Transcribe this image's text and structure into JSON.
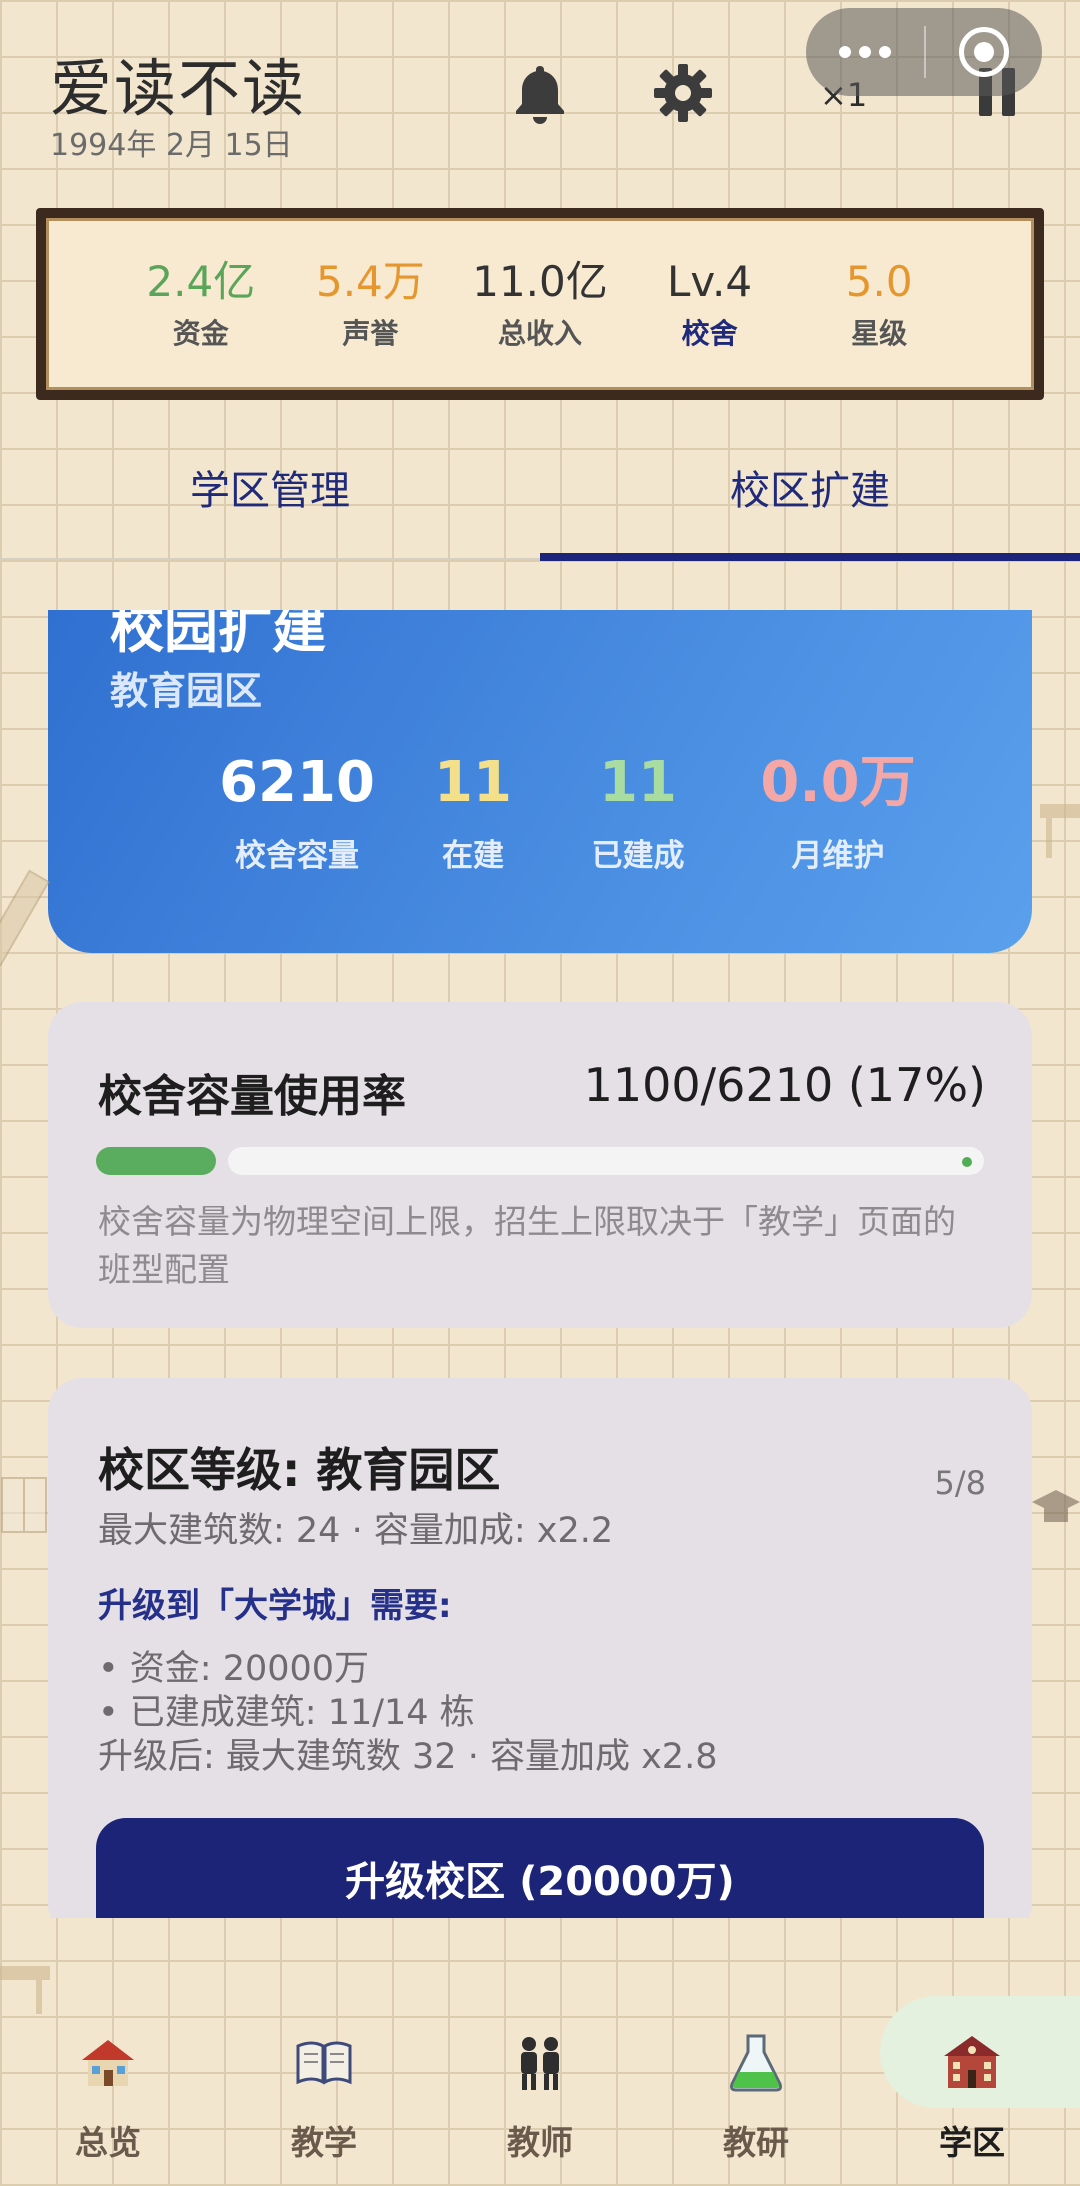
{
  "header": {
    "app_title": "爱读不读",
    "date": "1994年 2月 15日",
    "speed": "×1"
  },
  "stats": [
    {
      "value": "2.4亿",
      "label": "资金",
      "color": "#5aa55a",
      "label_color": "#555555"
    },
    {
      "value": "5.4万",
      "label": "声誉",
      "color": "#e6962e",
      "label_color": "#555555"
    },
    {
      "value": "11.0亿",
      "label": "总收入",
      "color": "#333333",
      "label_color": "#555555"
    },
    {
      "value": "Lv.4",
      "label": "校舍",
      "color": "#333333",
      "label_color": "#1f2a7a"
    },
    {
      "value": "5.0",
      "label": "星级",
      "color": "#e6962e",
      "label_color": "#555555"
    }
  ],
  "tabs": [
    {
      "label": "学区管理",
      "active": false
    },
    {
      "label": "校区扩建",
      "active": true
    }
  ],
  "campus": {
    "title": "校园扩建",
    "subtitle": "教育园区",
    "stats": [
      {
        "value": "6210",
        "label": "校舍容量",
        "color": "#ffffff"
      },
      {
        "value": "11",
        "label": "在建",
        "color": "#f4e08a"
      },
      {
        "value": "11",
        "label": "已建成",
        "color": "#a8dca0"
      },
      {
        "value": "0.0万",
        "label": "月维护",
        "color": "#f3a7a7"
      }
    ]
  },
  "usage": {
    "title": "校舍容量使用率",
    "value": "1100/6210 (17%)",
    "fraction": 0.17,
    "note": "校舍容量为物理空间上限，招生上限取决于「教学」页面的班型配置"
  },
  "level": {
    "title": "校区等级: 教育园区",
    "count": "5/8",
    "details": "最大建筑数: 24 · 容量加成: x2.2",
    "upgrade_heading": "升级到「大学城」需要:",
    "req_funds": "• 资金: 20000万",
    "req_buildings": "• 已建成建筑: 11/14 栋",
    "after": "升级后: 最大建筑数 32 · 容量加成 x2.8",
    "button": "升级校区 (20000万)"
  },
  "nav": [
    {
      "label": "总览",
      "icon": "school-house-icon"
    },
    {
      "label": "教学",
      "icon": "open-book-icon"
    },
    {
      "label": "教师",
      "icon": "teachers-icon"
    },
    {
      "label": "教研",
      "icon": "flask-icon"
    },
    {
      "label": "学区",
      "icon": "school-district-icon",
      "active": true
    }
  ]
}
